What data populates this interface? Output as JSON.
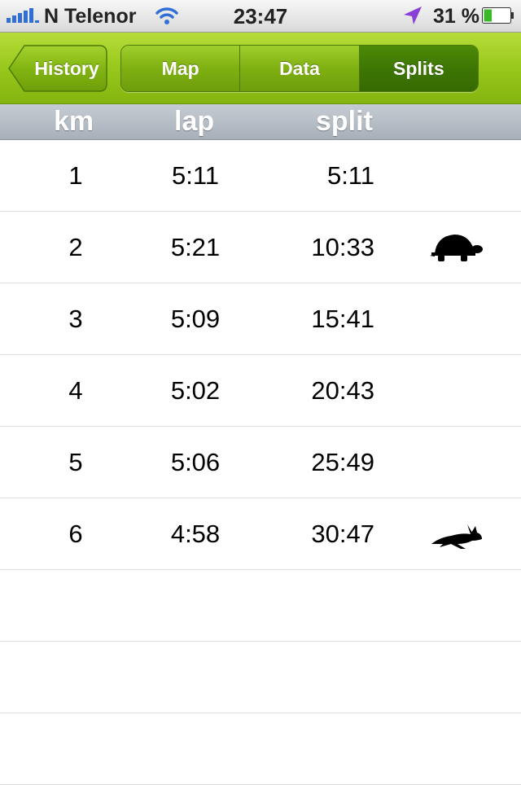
{
  "status_bar": {
    "carrier": "N Telenor",
    "time": "23:47",
    "battery": "31 %",
    "icons": [
      "signal-bars-icon",
      "wifi-icon",
      "location-arrow-icon",
      "battery-icon"
    ],
    "battery_level": 0.31
  },
  "nav": {
    "back_label": "History",
    "tabs": [
      {
        "label": "Map",
        "selected": false
      },
      {
        "label": "Data",
        "selected": false
      },
      {
        "label": "Splits",
        "selected": true
      }
    ],
    "accent": "#8cc21a",
    "selected_color": "#3d7504"
  },
  "columns": {
    "km": "km",
    "lap": "lap",
    "split": "split"
  },
  "rows": [
    {
      "km": "1",
      "lap": "5:11",
      "split": "5:11",
      "icon": ""
    },
    {
      "km": "2",
      "lap": "5:21",
      "split": "10:33",
      "icon": "turtle-icon"
    },
    {
      "km": "3",
      "lap": "5:09",
      "split": "15:41",
      "icon": ""
    },
    {
      "km": "4",
      "lap": "5:02",
      "split": "20:43",
      "icon": ""
    },
    {
      "km": "5",
      "lap": "5:06",
      "split": "25:49",
      "icon": ""
    },
    {
      "km": "6",
      "lap": "4:58",
      "split": "30:47",
      "icon": "hare-icon"
    }
  ],
  "empty_rows": 3
}
